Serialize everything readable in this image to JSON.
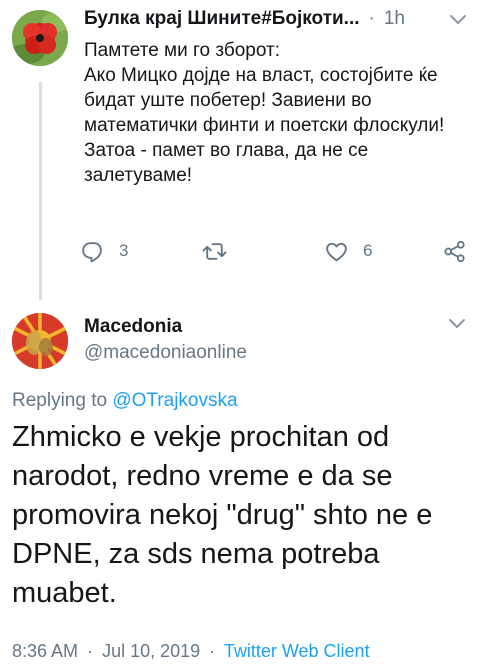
{
  "tweet1": {
    "author_name": "Булка крај Шините#Бојкоти...",
    "separator": "·",
    "time": "1h",
    "text_lines": [
      "Памтете ми го зборот:",
      "Ако Мицко дојде на власт, состојбите ќе бидат уште побетер! Завиени во математички финти и поетски флоскули!",
      "Затоа - памет во глава, да не се залетуваме!"
    ],
    "reply_count": "3",
    "like_count": "6"
  },
  "tweet2": {
    "author_name": "Macedonia",
    "handle": "@macedoniaonline",
    "replying_prefix": "Replying to",
    "replying_to": "@OTrajkovska",
    "text": "Zhmicko e vekje prochitan od narodot, redno vreme e da se promovira nekoj \"drug\" shto ne e DPNE, za sds nema potreba muabet.",
    "time": "8:36 AM",
    "date": "Jul 10, 2019",
    "client": "Twitter Web Client",
    "meta_separator": "·"
  },
  "colors": {
    "accent": "#1da1f2",
    "secondary_text": "#657786",
    "thread_line": "#d8dee3"
  }
}
